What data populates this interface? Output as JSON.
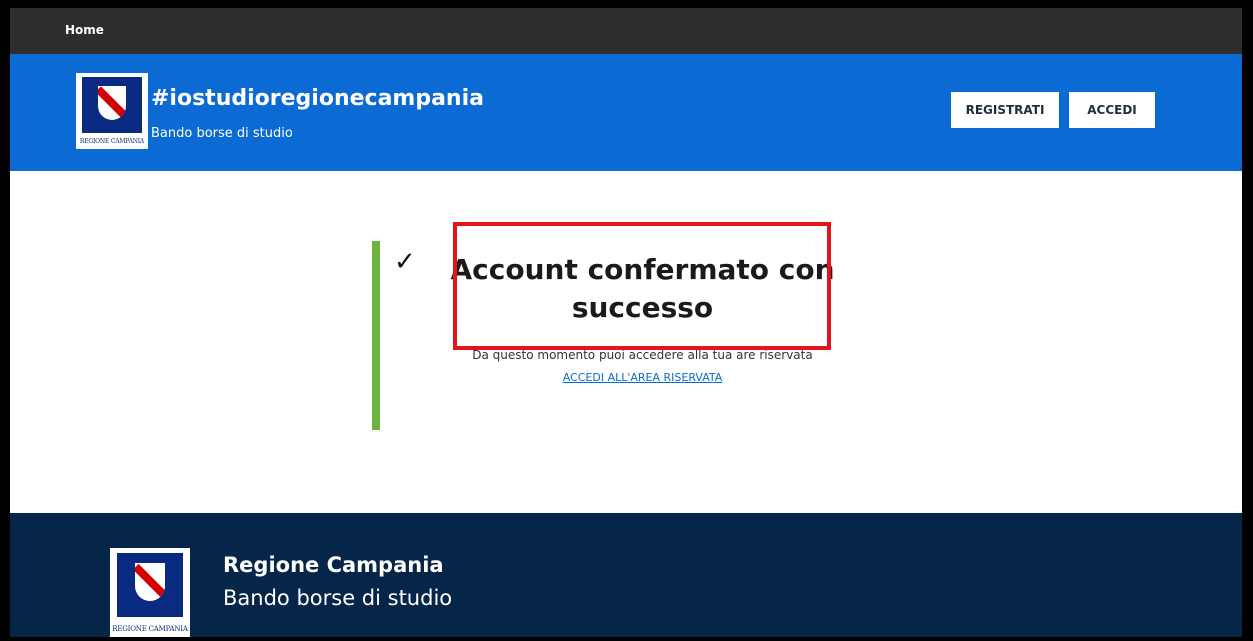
{
  "topbar": {
    "home_label": "Home"
  },
  "header": {
    "logo_caption": "REGIONE CAMPANIA",
    "title": "#iostudioregionecampania",
    "subtitle": "Bando borse di studio",
    "register_label": "REGISTRATI",
    "login_label": "ACCEDI"
  },
  "main": {
    "check_glyph": "✓",
    "headline": "Account confermato con successo",
    "message": "Da questo momento puoi accedere alla tua are riservata",
    "link_label": "ACCEDI ALL'AREA RISERVATA"
  },
  "footer": {
    "logo_caption": "REGIONE CAMPANIA",
    "title": "Regione Campania",
    "subtitle": "Bando borse di studio"
  },
  "colors": {
    "topbar": "#2d2e30",
    "header": "#0b6ad3",
    "success": "#6cb33f",
    "highlight": "#e5141c",
    "footer": "#062649"
  }
}
